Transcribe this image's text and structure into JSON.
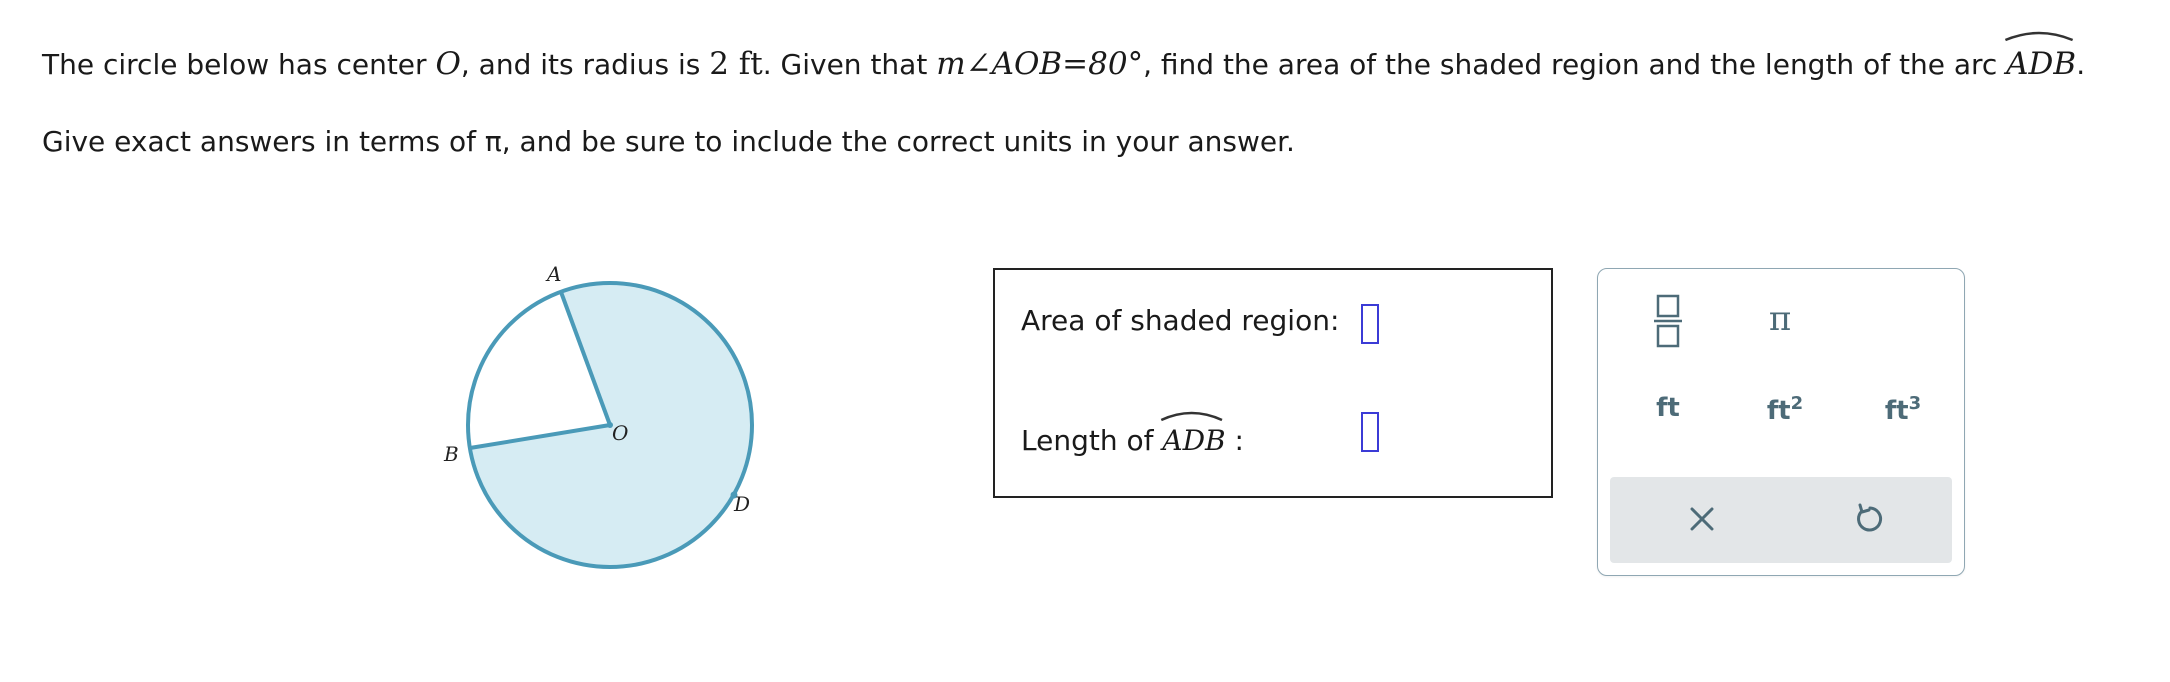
{
  "question": {
    "p1": "The circle below has center ",
    "center_label": "O",
    "p2": ", and its radius is ",
    "radius_value": "2 ft",
    "p3": ". Given that ",
    "angle_expr": "m∠AOB=80°",
    "p4": ", find the area of the shaded region and the length of the arc ",
    "arc_label": "ADB",
    "p5": ".",
    "line2": "Give exact answers in terms of π, and be sure to include the correct units in your answer."
  },
  "diagram": {
    "point_a": "A",
    "point_b": "B",
    "point_o": "O",
    "point_d": "D",
    "stroke_color": "#4a9ab8",
    "fill_color": "#d6ecf3"
  },
  "answers": {
    "area_label": "Area of shaded region:",
    "area_value": "",
    "length_label": "Length of ",
    "length_arc": "ADB",
    "length_suffix": " :",
    "length_value": ""
  },
  "keypad": {
    "pi": "π",
    "ft": "ft",
    "ft2_base": "ft",
    "ft2_exp": "2",
    "ft3_base": "ft",
    "ft3_exp": "3",
    "fraction_icon": "fraction-icon",
    "clear_icon": "close-icon",
    "undo_icon": "undo-icon"
  }
}
